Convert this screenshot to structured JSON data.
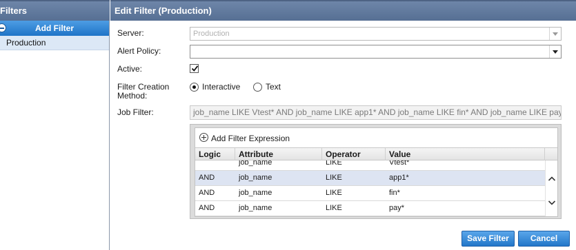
{
  "left_panel": {
    "title": "Filters",
    "add_filter_label": "Add Filter",
    "items": [
      {
        "label": "Production"
      }
    ]
  },
  "right_panel": {
    "title": "Edit Filter (Production)",
    "server": {
      "label": "Server:",
      "value": "Production"
    },
    "alert_policy": {
      "label": "Alert Policy:",
      "value": ""
    },
    "active": {
      "label": "Active:",
      "checked": true
    },
    "filter_creation": {
      "label_line1": "Filter Creation",
      "label_line2": "Method:",
      "options": [
        {
          "label": "Interactive",
          "selected": true
        },
        {
          "label": "Text",
          "selected": false
        }
      ]
    },
    "job_filter": {
      "label": "Job Filter:",
      "value": "job_name LIKE Vtest* AND job_name LIKE app1* AND job_name LIKE fin* AND job_name LIKE pay*"
    },
    "expressions": {
      "add_label": "Add Filter Expression",
      "columns": [
        "Logic",
        "Attribute",
        "Operator",
        "Value"
      ],
      "rows": [
        {
          "logic": "",
          "attribute": "job_name",
          "operator": "LIKE",
          "value": "Vtest*"
        },
        {
          "logic": "AND",
          "attribute": "job_name",
          "operator": "LIKE",
          "value": "app1*"
        },
        {
          "logic": "AND",
          "attribute": "job_name",
          "operator": "LIKE",
          "value": "fin*"
        },
        {
          "logic": "AND",
          "attribute": "job_name",
          "operator": "LIKE",
          "value": "pay*"
        }
      ],
      "selected_row": 1
    },
    "buttons": {
      "save": "Save Filter",
      "cancel": "Cancel"
    }
  },
  "colors": {
    "header": "#5f7899",
    "accent": "#2a7fd0",
    "selection": "#dde4f2"
  }
}
